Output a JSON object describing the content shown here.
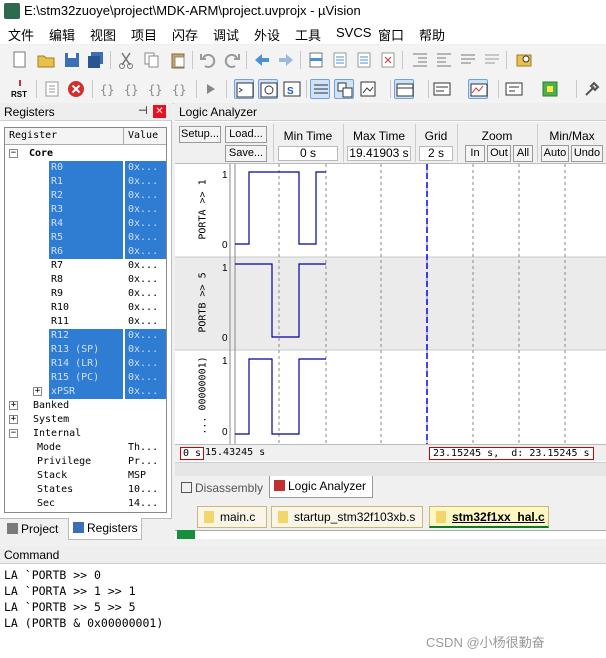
{
  "window": {
    "title": "E:\\stm32zuoye\\project\\MDK-ARM\\project.uvprojx - µVision"
  },
  "menu": [
    "文件",
    "编辑",
    "视图",
    "项目",
    "闪存",
    "调试",
    "外设",
    "工具",
    "SVCS",
    "窗口",
    "帮助"
  ],
  "toolbar2": {
    "rst_label": "RST"
  },
  "registers": {
    "title": "Registers",
    "pin_icon": "pin-icon",
    "col_register": "Register",
    "col_value": "Value",
    "rows": [
      {
        "name": "Core",
        "value": "",
        "indent": 0,
        "sel": false,
        "tree": "−",
        "bold": true
      },
      {
        "name": "R0",
        "value": "0x...",
        "indent": 2,
        "sel": true
      },
      {
        "name": "R1",
        "value": "0x...",
        "indent": 2,
        "sel": true
      },
      {
        "name": "R2",
        "value": "0x...",
        "indent": 2,
        "sel": true
      },
      {
        "name": "R3",
        "value": "0x...",
        "indent": 2,
        "sel": true
      },
      {
        "name": "R4",
        "value": "0x...",
        "indent": 2,
        "sel": true
      },
      {
        "name": "R5",
        "value": "0x...",
        "indent": 2,
        "sel": true
      },
      {
        "name": "R6",
        "value": "0x...",
        "indent": 2,
        "sel": true
      },
      {
        "name": "R7",
        "value": "0x...",
        "indent": 2,
        "sel": false
      },
      {
        "name": "R8",
        "value": "0x...",
        "indent": 2,
        "sel": false
      },
      {
        "name": "R9",
        "value": "0x...",
        "indent": 2,
        "sel": false
      },
      {
        "name": "R10",
        "value": "0x...",
        "indent": 2,
        "sel": false
      },
      {
        "name": "R11",
        "value": "0x...",
        "indent": 2,
        "sel": false
      },
      {
        "name": "R12",
        "value": "0x...",
        "indent": 2,
        "sel": true
      },
      {
        "name": "R13 (SP)",
        "value": "0x...",
        "indent": 2,
        "sel": true
      },
      {
        "name": "R14 (LR)",
        "value": "0x...",
        "indent": 2,
        "sel": true
      },
      {
        "name": "R15 (PC)",
        "value": "0x...",
        "indent": 2,
        "sel": true
      },
      {
        "name": "xPSR",
        "value": "0x...",
        "indent": 2,
        "sel": true,
        "tree": "+"
      },
      {
        "name": "Banked",
        "value": "",
        "indent": 1,
        "sel": false,
        "tree": "+"
      },
      {
        "name": "System",
        "value": "",
        "indent": 1,
        "sel": false,
        "tree": "+"
      },
      {
        "name": "Internal",
        "value": "",
        "indent": 1,
        "sel": false,
        "tree": "−"
      },
      {
        "name": "Mode",
        "value": "Th...",
        "indent": 3,
        "sel": false
      },
      {
        "name": "Privilege",
        "value": "Pr...",
        "indent": 3,
        "sel": false
      },
      {
        "name": "Stack",
        "value": "MSP",
        "indent": 3,
        "sel": false
      },
      {
        "name": "States",
        "value": "10...",
        "indent": 3,
        "sel": false
      },
      {
        "name": "Sec",
        "value": "14...",
        "indent": 3,
        "sel": false
      }
    ],
    "tabs": [
      {
        "label": "Project",
        "active": false
      },
      {
        "label": "Registers",
        "active": true
      }
    ]
  },
  "logic_analyzer": {
    "title": "Logic Analyzer",
    "setup_label": "Setup...",
    "load_label": "Load...",
    "save_label": "Save...",
    "min_time_label": "Min Time",
    "min_time_value": "0 s",
    "max_time_label": "Max Time",
    "max_time_value": "19.41903 s",
    "grid_label": "Grid",
    "grid_value": "2 s",
    "zoom_label": "Zoom",
    "zoom_in": "In",
    "zoom_out": "Out",
    "zoom_all": "All",
    "minmax_label": "Min/Max",
    "auto_label": "Auto",
    "undo_label": "Undo",
    "signals": [
      {
        "name": "PORTA >> 1",
        "hi": "1",
        "lo": "0"
      },
      {
        "name": "PORTB >> 5",
        "hi": "1",
        "lo": "0"
      },
      {
        "name": "... 00000001)",
        "hi": "1",
        "lo": "0"
      }
    ],
    "status_left_zero": "0 s",
    "status_left_time": "15.43245 s",
    "status_right": "23.15245 s,  d: 23.15245 s"
  },
  "bottom_tabs": [
    {
      "label": "Disassembly",
      "active": false
    },
    {
      "label": "Logic Analyzer",
      "active": true
    }
  ],
  "file_tabs": [
    {
      "label": "main.c",
      "active": false
    },
    {
      "label": "startup_stm32f103xb.s",
      "active": false
    },
    {
      "label": "stm32f1xx_hal.c",
      "active": true
    }
  ],
  "command": {
    "title": "Command",
    "lines": [
      "LA `PORTB >> 0",
      "LA `PORTA >> 1 >> 1",
      "LA `PORTB >> 5 >> 5",
      "LA (PORTB & 0x00000001)"
    ]
  },
  "watermark": "CSDN @小杨很勤奋",
  "colors": {
    "selection": "#2f7cd3",
    "wave": "#0000a0",
    "cursor": "#0000ff",
    "status_red": "#d00000"
  }
}
